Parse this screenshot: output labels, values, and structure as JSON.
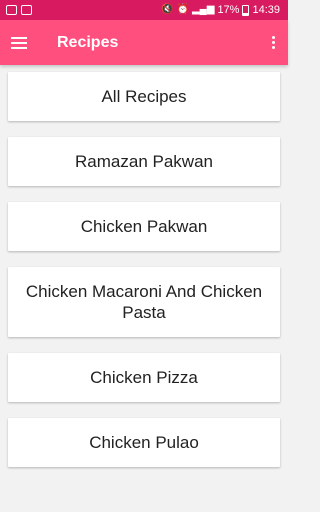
{
  "status_bar": {
    "battery_percent": "17%",
    "time": "14:39"
  },
  "app_bar": {
    "title": "Recipes"
  },
  "recipes": [
    {
      "label": "All Recipes"
    },
    {
      "label": "Ramazan Pakwan"
    },
    {
      "label": "Chicken Pakwan"
    },
    {
      "label": "Chicken Macaroni And Chicken Pasta"
    },
    {
      "label": "Chicken Pizza"
    },
    {
      "label": "Chicken Pulao"
    }
  ],
  "colors": {
    "status_bar": "#d81b60",
    "app_bar": "#ff4f7e",
    "background": "#f2f2f2"
  }
}
